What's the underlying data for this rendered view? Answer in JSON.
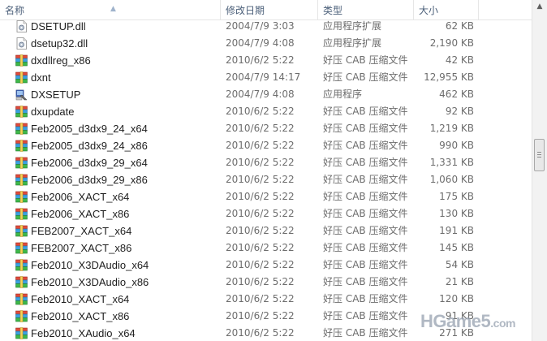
{
  "columns": {
    "name": "名称",
    "date": "修改日期",
    "type": "类型",
    "size": "大小"
  },
  "files": [
    {
      "name": "DSETUP.dll",
      "date": "2004/7/9 3:03",
      "type": "应用程序扩展",
      "size": "62 KB",
      "icon": "dll-icon"
    },
    {
      "name": "dsetup32.dll",
      "date": "2004/7/9 4:08",
      "type": "应用程序扩展",
      "size": "2,190 KB",
      "icon": "dll-icon"
    },
    {
      "name": "dxdllreg_x86",
      "date": "2010/6/2 5:22",
      "type": "好压 CAB 压缩文件",
      "size": "42 KB",
      "icon": "cab-archive-icon"
    },
    {
      "name": "dxnt",
      "date": "2004/7/9 14:17",
      "type": "好压 CAB 压缩文件",
      "size": "12,955 KB",
      "icon": "cab-archive-icon"
    },
    {
      "name": "DXSETUP",
      "date": "2004/7/9 4:08",
      "type": "应用程序",
      "size": "462 KB",
      "icon": "setup-exe-icon"
    },
    {
      "name": "dxupdate",
      "date": "2010/6/2 5:22",
      "type": "好压 CAB 压缩文件",
      "size": "92 KB",
      "icon": "cab-archive-icon"
    },
    {
      "name": "Feb2005_d3dx9_24_x64",
      "date": "2010/6/2 5:22",
      "type": "好压 CAB 压缩文件",
      "size": "1,219 KB",
      "icon": "cab-archive-icon"
    },
    {
      "name": "Feb2005_d3dx9_24_x86",
      "date": "2010/6/2 5:22",
      "type": "好压 CAB 压缩文件",
      "size": "990 KB",
      "icon": "cab-archive-icon"
    },
    {
      "name": "Feb2006_d3dx9_29_x64",
      "date": "2010/6/2 5:22",
      "type": "好压 CAB 压缩文件",
      "size": "1,331 KB",
      "icon": "cab-archive-icon"
    },
    {
      "name": "Feb2006_d3dx9_29_x86",
      "date": "2010/6/2 5:22",
      "type": "好压 CAB 压缩文件",
      "size": "1,060 KB",
      "icon": "cab-archive-icon"
    },
    {
      "name": "Feb2006_XACT_x64",
      "date": "2010/6/2 5:22",
      "type": "好压 CAB 压缩文件",
      "size": "175 KB",
      "icon": "cab-archive-icon"
    },
    {
      "name": "Feb2006_XACT_x86",
      "date": "2010/6/2 5:22",
      "type": "好压 CAB 压缩文件",
      "size": "130 KB",
      "icon": "cab-archive-icon"
    },
    {
      "name": "FEB2007_XACT_x64",
      "date": "2010/6/2 5:22",
      "type": "好压 CAB 压缩文件",
      "size": "191 KB",
      "icon": "cab-archive-icon"
    },
    {
      "name": "FEB2007_XACT_x86",
      "date": "2010/6/2 5:22",
      "type": "好压 CAB 压缩文件",
      "size": "145 KB",
      "icon": "cab-archive-icon"
    },
    {
      "name": "Feb2010_X3DAudio_x64",
      "date": "2010/6/2 5:22",
      "type": "好压 CAB 压缩文件",
      "size": "54 KB",
      "icon": "cab-archive-icon"
    },
    {
      "name": "Feb2010_X3DAudio_x86",
      "date": "2010/6/2 5:22",
      "type": "好压 CAB 压缩文件",
      "size": "21 KB",
      "icon": "cab-archive-icon"
    },
    {
      "name": "Feb2010_XACT_x64",
      "date": "2010/6/2 5:22",
      "type": "好压 CAB 压缩文件",
      "size": "120 KB",
      "icon": "cab-archive-icon"
    },
    {
      "name": "Feb2010_XACT_x86",
      "date": "2010/6/2 5:22",
      "type": "好压 CAB 压缩文件",
      "size": "91 KB",
      "icon": "cab-archive-icon"
    },
    {
      "name": "Feb2010_XAudio_x64",
      "date": "2010/6/2 5:22",
      "type": "好压 CAB 压缩文件",
      "size": "271 KB",
      "icon": "cab-archive-icon"
    }
  ],
  "watermark": {
    "main": "HGame5",
    "suffix": ".com"
  }
}
